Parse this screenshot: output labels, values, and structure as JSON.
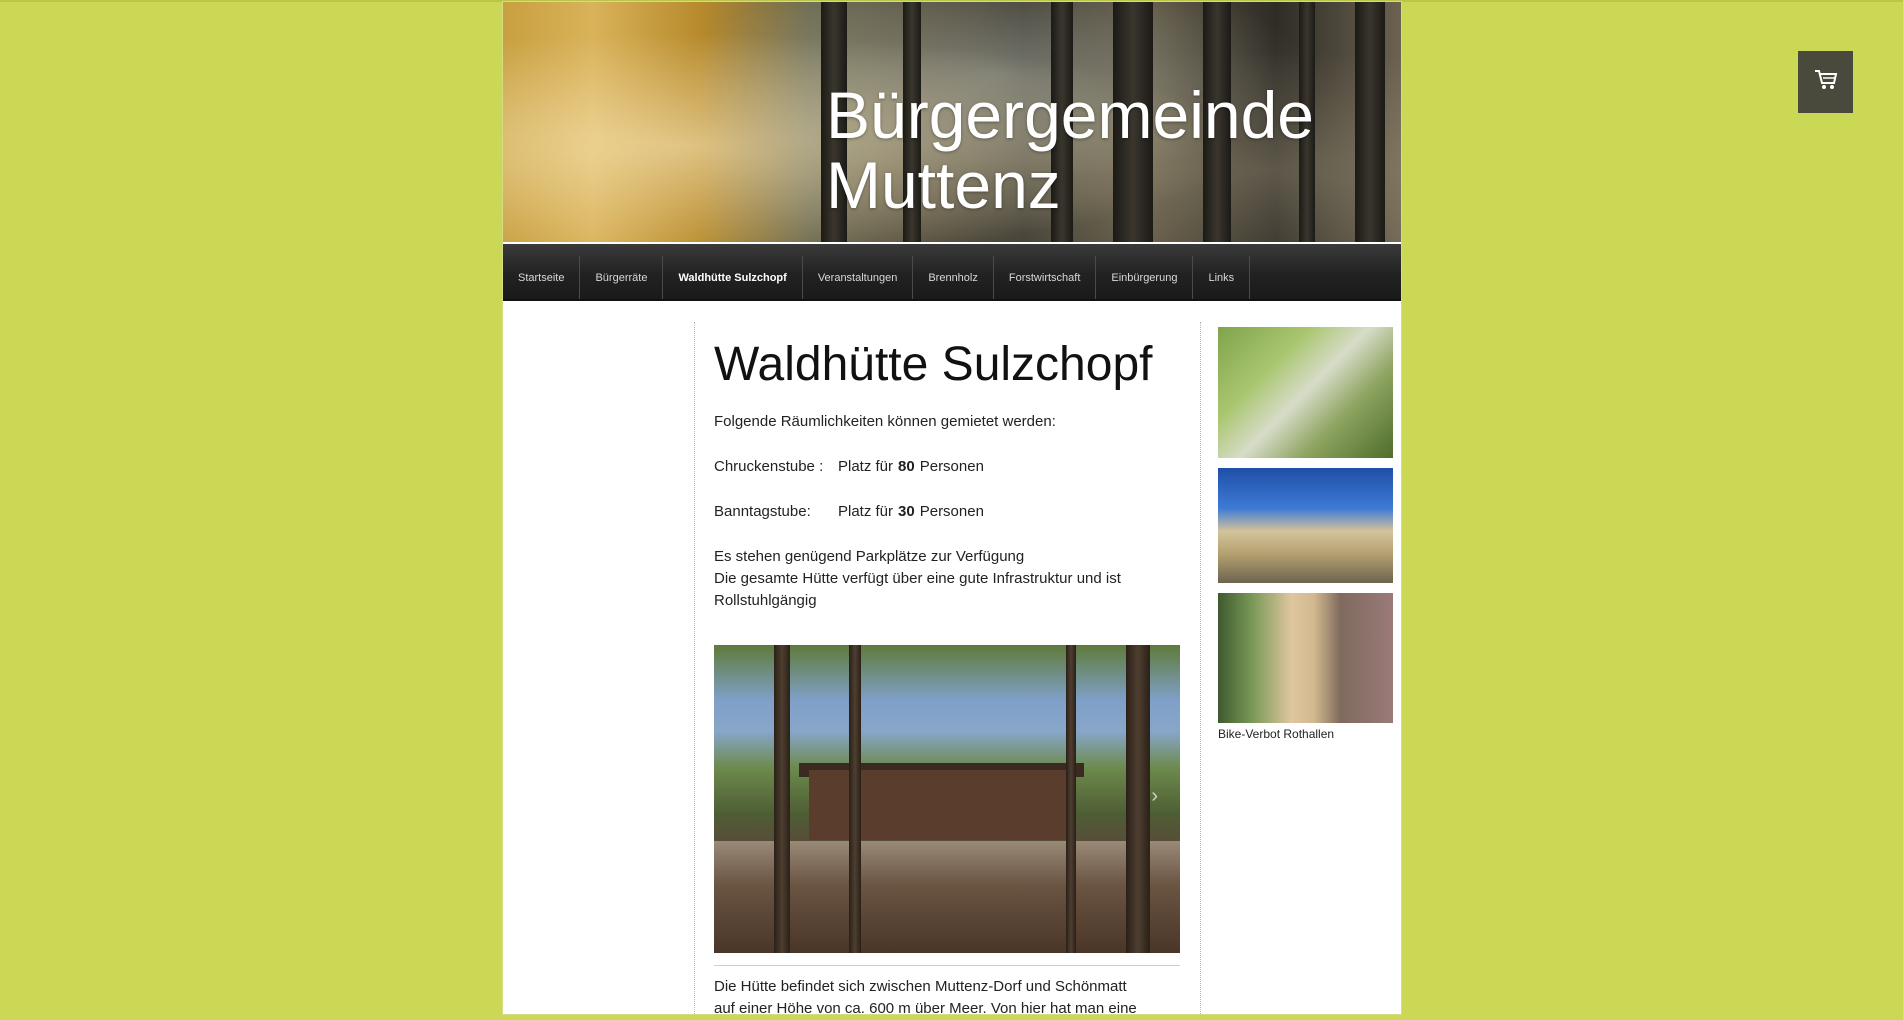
{
  "header": {
    "title_line1": "Bürgergemeinde",
    "title_line2": "Muttenz"
  },
  "nav": {
    "items": [
      {
        "label": "Startseite"
      },
      {
        "label": "Bürgerräte"
      },
      {
        "label": "Waldhütte Sulzchopf",
        "active": true
      },
      {
        "label": "Veranstaltungen"
      },
      {
        "label": "Brennholz"
      },
      {
        "label": "Forstwirtschaft"
      },
      {
        "label": "Einbürgerung"
      },
      {
        "label": "Links"
      }
    ]
  },
  "main": {
    "title": "Waldhütte Sulzchopf",
    "intro": "Folgende Räumlichkeiten können gemietet werden:",
    "rooms": [
      {
        "name": "Chruckenstube",
        "sep": ":",
        "text": "Platz für",
        "count": "80",
        "unit": "Personen"
      },
      {
        "name": "Banntagstube:",
        "sep": "",
        "text": "Platz für",
        "count": "30",
        "unit": "Personen"
      }
    ],
    "parking": "Es stehen genügend Parkplätze zur Verfügung",
    "infra": "Die gesamte Hütte verfügt über eine gute Infrastruktur und ist Rollstuhlgängig",
    "description_line1": "Die Hütte befindet sich zwischen Muttenz-Dorf und Schönmatt",
    "description_line2": "auf einer Höhe von ca. 600 m über Meer. Von hier hat man eine"
  },
  "sidebar": {
    "caption": "Bike-Verbot Rothallen"
  },
  "icons": {
    "cart": "shopping-cart-icon",
    "slider_next": "chevron-right-icon"
  },
  "colors": {
    "page_background": "#cbd855",
    "nav_background": "#222222",
    "cart_background": "#4a4a3c"
  }
}
